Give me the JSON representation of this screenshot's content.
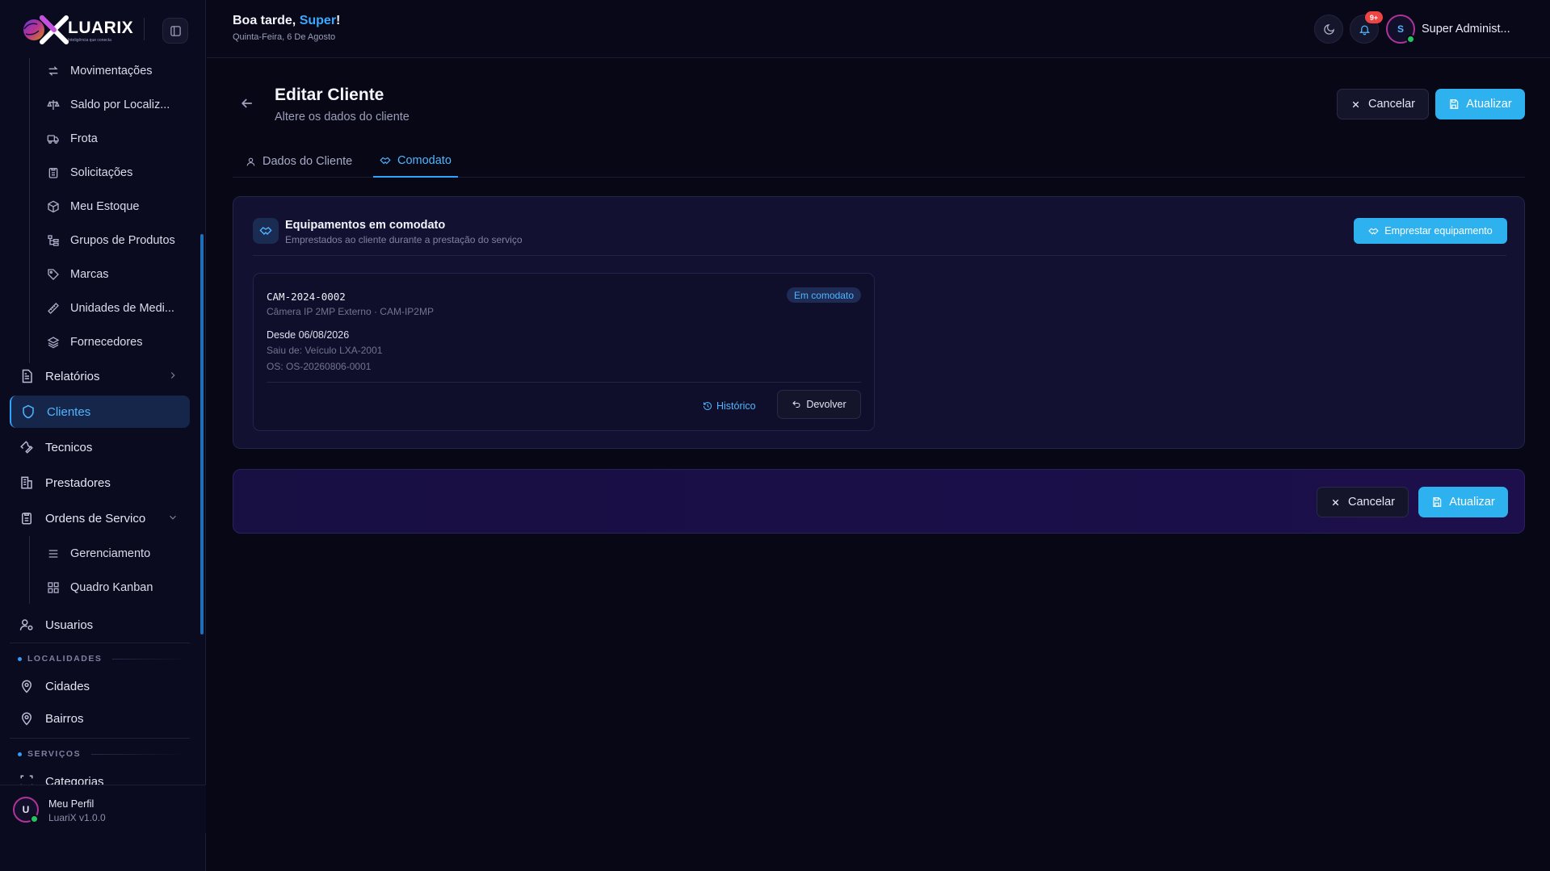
{
  "brand": {
    "name": "LUARIX",
    "tagline": "Inteligência que conecta"
  },
  "sidebar": {
    "inventory_items": [
      {
        "label": "Movimentações",
        "icon": "arrows-exchange-icon"
      },
      {
        "label": "Saldo por Localiz...",
        "icon": "scale-icon"
      },
      {
        "label": "Frota",
        "icon": "truck-icon"
      },
      {
        "label": "Solicitações",
        "icon": "clipboard-icon"
      },
      {
        "label": "Meu Estoque",
        "icon": "package-icon"
      },
      {
        "label": "Grupos de Produtos",
        "icon": "tree-icon"
      },
      {
        "label": "Marcas",
        "icon": "tag-icon"
      },
      {
        "label": "Unidades de Medi...",
        "icon": "ruler-icon"
      },
      {
        "label": "Fornecedores",
        "icon": "layers-icon"
      }
    ],
    "relatorios": "Relatórios",
    "clientes": "Clientes",
    "tecnicos": "Tecnicos",
    "prestadores": "Prestadores",
    "ordens": "Ordens de Servico",
    "ordens_sub": [
      {
        "label": "Gerenciamento",
        "icon": "list-icon"
      },
      {
        "label": "Quadro Kanban",
        "icon": "kanban-icon"
      }
    ],
    "usuarios": "Usuarios",
    "section_localidades": "LOCALIDADES",
    "cidades": "Cidades",
    "bairros": "Bairros",
    "section_servicos": "SERVIÇOS",
    "categorias": "Categorias",
    "profile": {
      "initial": "U",
      "name": "Meu Perfil",
      "version": "LuariX v1.0.0"
    }
  },
  "header": {
    "greeting": "Boa tarde,",
    "user_first": "Super",
    "exclaim": "!",
    "date": "Quinta-Feira, 6 De Agosto",
    "notif_count": "9+",
    "avatar_initial": "S",
    "user_name": "Super Administ..."
  },
  "page": {
    "title": "Editar Cliente",
    "subtitle": "Altere os dados do cliente",
    "cancel_label": "Cancelar",
    "update_label": "Atualizar"
  },
  "tabs": [
    {
      "label": "Dados do Cliente"
    },
    {
      "label": "Comodato"
    }
  ],
  "comodato": {
    "title": "Equipamentos em comodato",
    "subtitle": "Emprestados ao cliente durante a prestação do serviço",
    "lend_label": "Emprestar equipamento",
    "card": {
      "code": "CAM-2024-0002",
      "status": "Em comodato",
      "model": "Câmera IP 2MP Externo · CAM-IP2MP",
      "since": "Desde 06/08/2026",
      "from": "Saiu de: Veículo LXA-2001",
      "os": "OS: OS-20260806-0001",
      "history_label": "Histórico",
      "return_label": "Devolver"
    }
  },
  "footer": {
    "cancel_label": "Cancelar",
    "update_label": "Atualizar"
  },
  "colors": {
    "accent": "#2eb2ef",
    "active_nav": "#4fb6ff",
    "badge": "#ef4444",
    "online": "#22c55e"
  }
}
